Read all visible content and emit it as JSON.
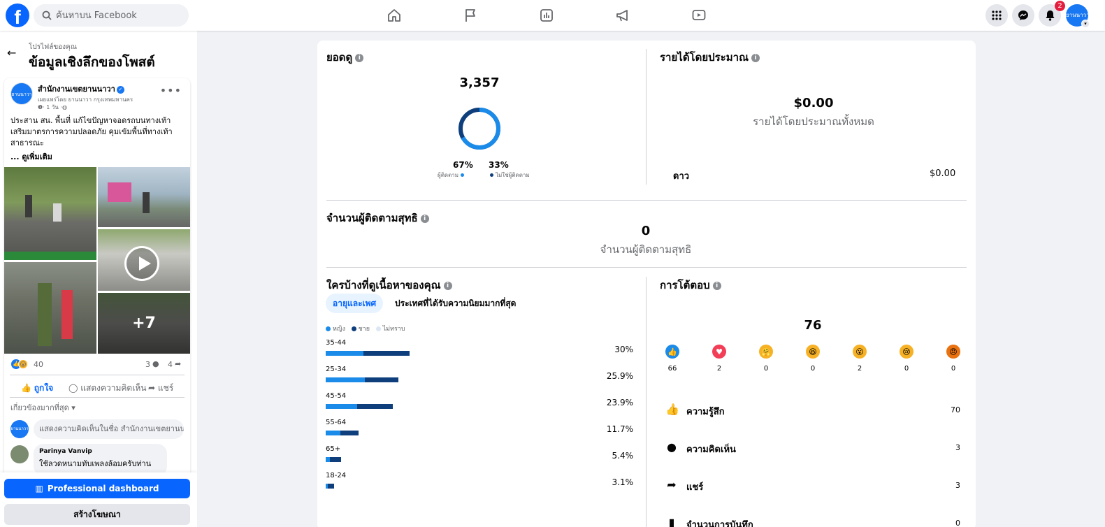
{
  "topbar": {
    "logo": "f",
    "search_placeholder": "ค้นหาบน Facebook",
    "notification_count": "2",
    "avatar_text": "ยานนาวา"
  },
  "sidebar": {
    "breadcrumb": "โปรไฟล์ของคุณ",
    "title": "ข้อมูลเชิงลึกของโพสต์",
    "post": {
      "page_name": "สำนักงานเขตยานนาวา",
      "avatar_text": "ยานนาวา",
      "publisher": "เผยแพร่โดย ยานนาวา กรุงเทพมหานคร",
      "time": "· 1 วัน ·",
      "text": "ประสาน สน. พื้นที่ แก้ไขปัญหาจอดรถบนทางเท้า เสริมมาตรการความปลอดภัย คุมเข้มพื้นที่ทางเท้าสาธารณะ",
      "see_more": "... ดูเพิ่มเติม",
      "more_photos": "+7",
      "reaction_count": "40",
      "comment_count": "3",
      "share_count": "4",
      "like_label": "ถูกใจ",
      "comment_label": "แสดงความคิดเห็น",
      "share_label": "แชร์",
      "relevance_label": "เกี่ยวข้องมากที่สุด",
      "comment_placeholder": "แสดงความคิดเห็นในชื่อ สำนักงานเขตยานนาวา",
      "comment": {
        "author": "Parinya Vanvip",
        "text": "ใช้ลวดหนามทับเพลงล้อมครับท่าน"
      }
    },
    "pro_dashboard_label": "Professional dashboard",
    "create_ad_label": "สร้างโฆษณา"
  },
  "views": {
    "title": "ยอดดู",
    "total": "3,357",
    "followers_pct": "67%",
    "followers_label": "ผู้ติดตาม",
    "followers_fraction": 0.67,
    "non_followers_pct": "33%",
    "non_followers_label": "ไม่ใช่ผู้ติดตาม"
  },
  "revenue": {
    "title": "รายได้โดยประมาณ",
    "total": "$0.00",
    "subtitle": "รายได้โดยประมาณทั้งหมด",
    "row_label": "ดาว",
    "row_value": "$0.00"
  },
  "net_followers": {
    "title": "จำนวนผู้ติดตามสุทธิ",
    "value": "0",
    "subtitle": "จำนวนผู้ติดตามสุทธิ"
  },
  "audience": {
    "title": "ใครบ้างที่ดูเนื้อหาของคุณ",
    "tab_active": "อายุและเพศ",
    "tab_other": "ประเทศที่ได้รับความนิยมมากที่สุด",
    "legend": {
      "women": "หญิง",
      "men": "ชาย",
      "unknown": "ไม่ทราบ"
    },
    "colors": {
      "women": "#1b8be9",
      "men": "#0e3e7b",
      "unknown": "#dbe7f5"
    },
    "rows": [
      {
        "label": "35-44",
        "pct": "30%",
        "total": 30,
        "women": 13.5,
        "men": 16.5
      },
      {
        "label": "25-34",
        "pct": "25.9%",
        "total": 25.9,
        "women": 14.1,
        "men": 11.8
      },
      {
        "label": "45-54",
        "pct": "23.9%",
        "total": 23.9,
        "women": 11.2,
        "men": 12.7
      },
      {
        "label": "55-64",
        "pct": "11.7%",
        "total": 11.7,
        "women": 5.3,
        "men": 6.4
      },
      {
        "label": "65+",
        "pct": "5.4%",
        "total": 5.4,
        "women": 1.6,
        "men": 3.8
      },
      {
        "label": "18-24",
        "pct": "3.1%",
        "total": 3.1,
        "women": 0.8,
        "men": 2.3
      }
    ]
  },
  "interactions": {
    "title": "การโต้ตอบ",
    "total": "76",
    "reactions": [
      {
        "name": "like",
        "count": "66"
      },
      {
        "name": "love",
        "count": "2"
      },
      {
        "name": "care",
        "count": "0"
      },
      {
        "name": "haha",
        "count": "0"
      },
      {
        "name": "wow",
        "count": "2"
      },
      {
        "name": "sad",
        "count": "0"
      },
      {
        "name": "angry",
        "count": "0"
      }
    ],
    "stats": [
      {
        "label": "ความรู้สึก",
        "value": "70"
      },
      {
        "label": "ความคิดเห็น",
        "value": "3"
      },
      {
        "label": "แชร์",
        "value": "3"
      },
      {
        "label": "จำนวนการบันทึก",
        "value": "0"
      }
    ]
  }
}
